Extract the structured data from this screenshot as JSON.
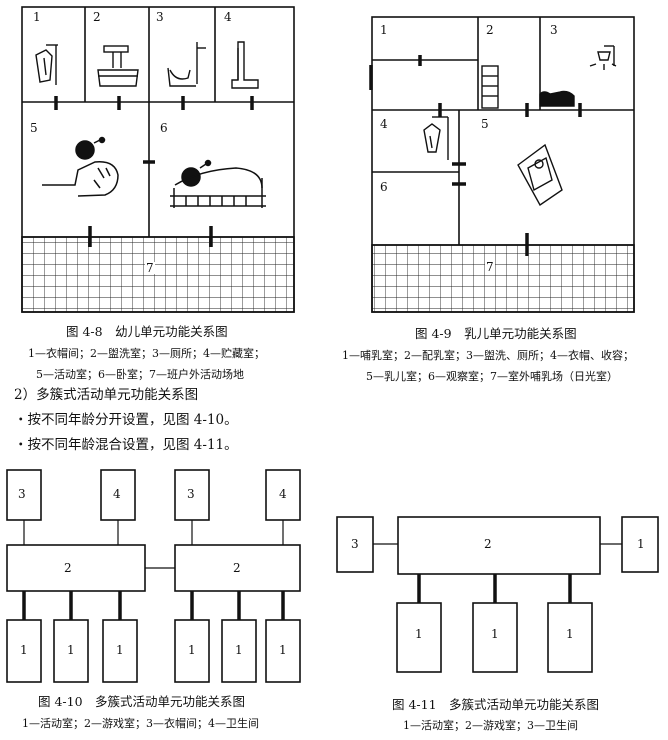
{
  "fig48": {
    "rooms": [
      "1",
      "2",
      "3",
      "4",
      "5",
      "6",
      "7"
    ],
    "caption": "图 4-8　幼儿单元功能关系图",
    "legend1": "1—衣帽间；2—盥洗室；3—厕所；4—贮藏室；",
    "legend2": "5—活动室；6—卧室；7—班户外活动场地"
  },
  "fig49": {
    "rooms": [
      "1",
      "2",
      "3",
      "4",
      "5",
      "6",
      "7"
    ],
    "caption": "图 4-9　乳儿单元功能关系图",
    "legend1": "1—哺乳室；2—配乳室；3—盥洗、厕所；4—衣帽、收容；",
    "legend2": "5—乳儿室；6—观察室；7—室外哺乳场（日光室）"
  },
  "section": {
    "heading": "2）多簇式活动单元功能关系图",
    "bullet1": "・按不同年龄分开设置，见图 4-10。",
    "bullet2": "・按不同年龄混合设置，见图 4-11。"
  },
  "fig410": {
    "left_labels": [
      "3",
      "4",
      "2",
      "1",
      "1",
      "1"
    ],
    "right_labels": [
      "3",
      "4",
      "2",
      "1",
      "1",
      "1"
    ],
    "caption": "图 4-10　多簇式活动单元功能关系图",
    "legend": "1—活动室；2—游戏室；3—衣帽间；4—卫生间"
  },
  "fig411": {
    "labels": [
      "3",
      "2",
      "1",
      "1",
      "1",
      "1"
    ],
    "caption": "图 4-11　多簇式活动单元功能关系图",
    "legend": "1—活动室；2—游戏室；3—卫生间"
  }
}
